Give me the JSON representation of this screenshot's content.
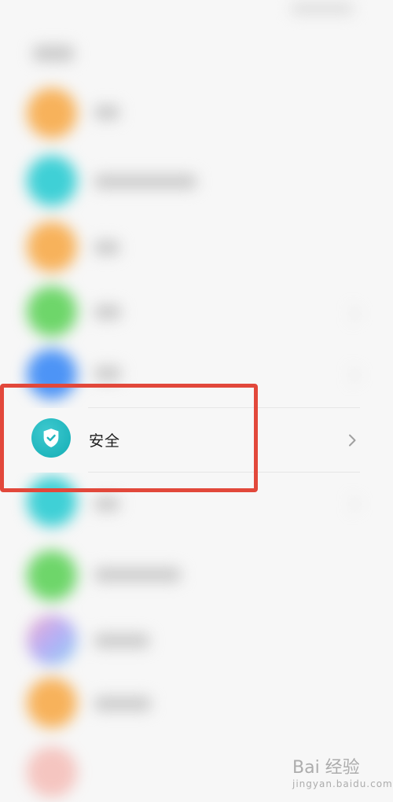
{
  "security_item": {
    "label": "安全",
    "icon": "shield-check-icon",
    "chevron": "chevron-right-icon"
  },
  "highlight": {
    "color": "#e2483b"
  },
  "colors": {
    "background": "#f7f7f7",
    "icon_teal": "#20b6bd",
    "text": "#1e1e1e"
  },
  "watermark": {
    "brand": "Bai 经验",
    "url": "jingyan.baidu.com"
  }
}
